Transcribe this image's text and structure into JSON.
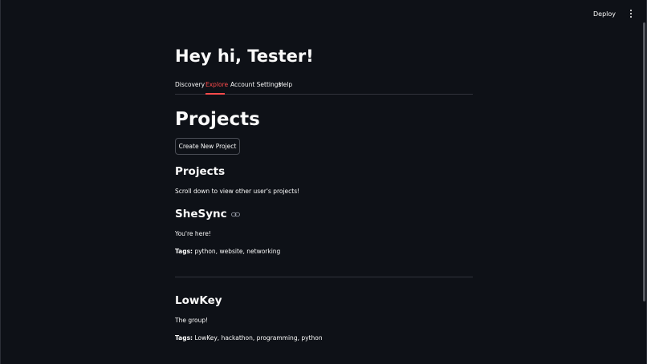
{
  "header": {
    "deploy_label": "Deploy"
  },
  "greeting": "Hey hi, Tester!",
  "tabs": [
    {
      "label": "Discovery",
      "active": false
    },
    {
      "label": "Explore",
      "active": true
    },
    {
      "label": "Account Settings",
      "active": false
    },
    {
      "label": "Help",
      "active": false
    }
  ],
  "page_title": "Projects",
  "create_button_label": "Create New Project",
  "projects_section": {
    "heading": "Projects",
    "description": "Scroll down to view other user's projects!"
  },
  "projects": [
    {
      "name": "SheSync",
      "description": "You're here!",
      "tags_label": "Tags:",
      "tags": "python, website, networking"
    },
    {
      "name": "LowKey",
      "description": "The group!",
      "tags_label": "Tags:",
      "tags": "LowKey, hackathon, programming, python"
    }
  ],
  "colors": {
    "background": "#0e1117",
    "accent": "#ff4b4b",
    "text": "#fafafa"
  }
}
